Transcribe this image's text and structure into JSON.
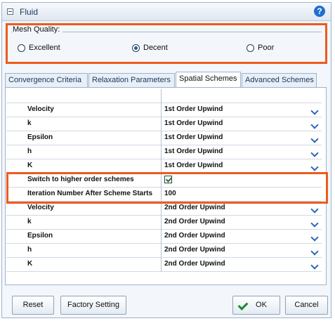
{
  "window": {
    "title": "Fluid"
  },
  "mesh_quality": {
    "label": "Mesh Quality:",
    "options": [
      {
        "label": "Excellent",
        "selected": false
      },
      {
        "label": "Decent",
        "selected": true
      },
      {
        "label": "Poor",
        "selected": false
      }
    ]
  },
  "tabs": [
    {
      "label": "Convergence Criteria",
      "active": false
    },
    {
      "label": "Relaxation Parameters",
      "active": false
    },
    {
      "label": "Spatial Schemes",
      "active": true
    },
    {
      "label": "Advanced Schemes",
      "active": false
    }
  ],
  "rows": [
    {
      "name": "",
      "value": "",
      "control": "none"
    },
    {
      "name": "Velocity",
      "value": "1st Order Upwind",
      "control": "dropdown"
    },
    {
      "name": "k",
      "value": "1st Order Upwind",
      "control": "dropdown"
    },
    {
      "name": "Epsilon",
      "value": "1st Order Upwind",
      "control": "dropdown"
    },
    {
      "name": "h",
      "value": "1st Order Upwind",
      "control": "dropdown"
    },
    {
      "name": "K",
      "value": "1st Order Upwind",
      "control": "dropdown"
    },
    {
      "name": "Switch to higher order schemes",
      "value": "",
      "control": "checkbox",
      "checked": true
    },
    {
      "name": "Iteration Number After Scheme Starts",
      "value": "100",
      "control": "text"
    },
    {
      "name": "Velocity",
      "value": "2nd Order Upwind",
      "control": "dropdown"
    },
    {
      "name": "k",
      "value": "2nd Order Upwind",
      "control": "dropdown"
    },
    {
      "name": "Epsilon",
      "value": "2nd Order Upwind",
      "control": "dropdown"
    },
    {
      "name": "h",
      "value": "2nd Order Upwind",
      "control": "dropdown"
    },
    {
      "name": "K",
      "value": "2nd Order Upwind",
      "control": "dropdown"
    }
  ],
  "buttons": {
    "reset": "Reset",
    "factory": "Factory Setting",
    "ok": "OK",
    "cancel": "Cancel"
  },
  "colors": {
    "highlight": "#ec5b1e",
    "accent": "#1f6fd1"
  }
}
